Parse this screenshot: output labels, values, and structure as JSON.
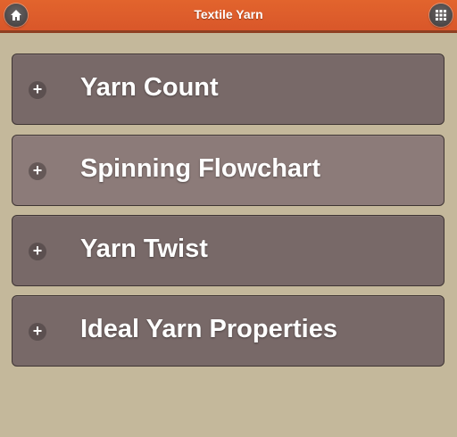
{
  "header": {
    "title": "Textile Yarn",
    "home_icon": "home-icon",
    "menu_icon": "grid-icon",
    "color": "#df5f2c"
  },
  "menu": {
    "items": [
      {
        "label": "Yarn Count",
        "icon": "plus-icon"
      },
      {
        "label": "Spinning Flowchart",
        "icon": "plus-icon"
      },
      {
        "label": "Yarn Twist",
        "icon": "plus-icon"
      },
      {
        "label": "Ideal Yarn Properties",
        "icon": "plus-icon"
      }
    ]
  },
  "colors": {
    "background": "#c4b89b",
    "item": "#786968",
    "item_highlight": "#8c7b79"
  }
}
